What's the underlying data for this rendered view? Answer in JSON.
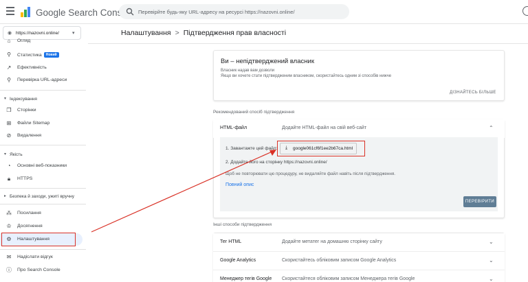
{
  "header": {
    "app_title": "Google Search Console",
    "search_placeholder": "Перевірйте будь-яку URL-адресу на ресурсі https://nazovni.online/"
  },
  "sidebar": {
    "property": "https://nazovni.online/",
    "items": {
      "overview": "Огляд",
      "statistics": "Статистика",
      "statistics_badge": "Новий",
      "performance": "Ефективність",
      "url_inspection": "Перевірка URL-адреси",
      "indexing_section": "Індексування",
      "pages": "Сторінки",
      "sitemaps": "Файли Sitemap",
      "removals": "Видалення",
      "experience_section": "Якість",
      "web_vitals": "Основні веб-показники",
      "https": "HTTPS",
      "security_section": "Безпека й заходи, ужиті вручну",
      "links": "Посилання",
      "achievements": "Досягнення",
      "settings": "Налаштування",
      "feedback": "Надіслати відгук",
      "about": "Про Search Console"
    }
  },
  "breadcrumb": {
    "parent": "Налаштування",
    "separator": ">",
    "current": "Підтвердження прав власності"
  },
  "owner_card": {
    "title": "Ви – непідтверджений власник",
    "line1": "Власник надав вам дозволи",
    "line2": "Якщо ви хочете стати підтвердженим власником, скористайтесь одним зі способів нижче",
    "learn_more": "ДІЗНАЙТЕСЬ БІЛЬШЕ"
  },
  "recommended": {
    "label": "Рекомендований спосіб підтвердження",
    "method": "HTML-файл",
    "description": "Додайте HTML-файл на свій веб-сайт",
    "step1": "1. Завантажте цей файл:",
    "filename": "google061cf6f1ee2b67ca.html",
    "step2_prefix": "2. Додайте його на сторінку",
    "step2_url": "https://nazovni.online/",
    "note": "Щоб не повторювати цю процедуру, не видаляйте файл навіть після підтвердження.",
    "full_details": "Повний опис",
    "verify": "ПЕРЕВІРИТИ"
  },
  "other": {
    "label": "Інші способи підтвердження",
    "methods": [
      {
        "name": "Тег HTML",
        "description": "Додайте метатег на домашню сторінку сайту"
      },
      {
        "name": "Google Analytics",
        "description": "Скористайтесь обліковим записом Google Analytics"
      },
      {
        "name": "Менеджер тегів Google",
        "description": "Скористайтеся обліковим записом Менеджера тегів Google"
      }
    ]
  },
  "colors": {
    "accent": "#1a73e8",
    "highlight": "#d93025",
    "verify_button": "#5f7d95"
  }
}
